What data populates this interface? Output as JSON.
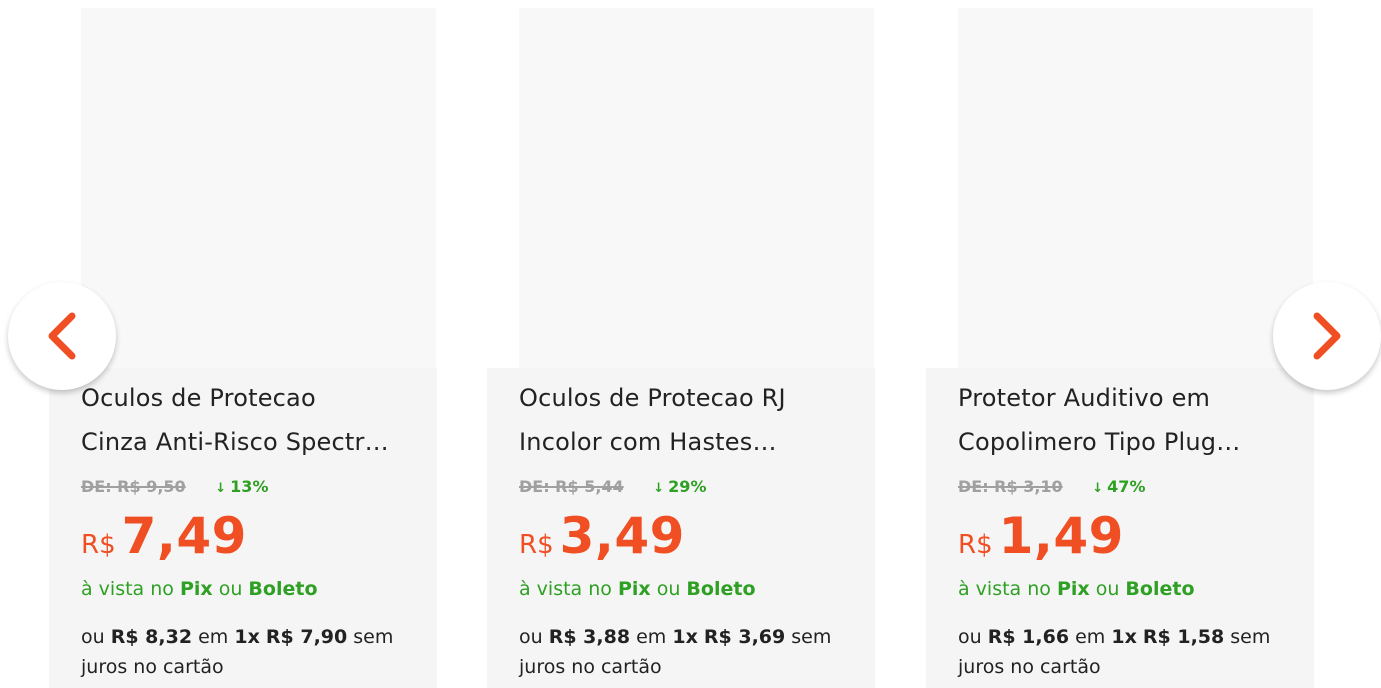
{
  "carousel": {
    "prev_icon": "chevron-left-icon",
    "next_icon": "chevron-right-icon",
    "accent_color": "#f04e23",
    "discount_color": "#2ea023"
  },
  "products": [
    {
      "title_line1": "Oculos de Protecao",
      "title_line2": "Cinza Anti-Risco Spectr…",
      "old_price": "DE: R$ 9,50",
      "discount": "13%",
      "currency": "R$",
      "price": "7,49",
      "pix_prefix": "à vista no",
      "pix_label": "Pix",
      "pix_or": "ou",
      "boleto_label": "Boleto",
      "inst_ou": "ou",
      "inst_total": "R$ 8,32",
      "inst_em": "em",
      "inst_count": "1x",
      "inst_value": "R$ 7,90",
      "inst_suffix": "sem juros no cartão"
    },
    {
      "title_line1": "Oculos de Protecao RJ",
      "title_line2": "Incolor com Hastes…",
      "old_price": "DE: R$ 5,44",
      "discount": "29%",
      "currency": "R$",
      "price": "3,49",
      "pix_prefix": "à vista no",
      "pix_label": "Pix",
      "pix_or": "ou",
      "boleto_label": "Boleto",
      "inst_ou": "ou",
      "inst_total": "R$ 3,88",
      "inst_em": "em",
      "inst_count": "1x",
      "inst_value": "R$ 3,69",
      "inst_suffix": "sem juros no cartão"
    },
    {
      "title_line1": "Protetor Auditivo em",
      "title_line2": "Copolimero Tipo Plug…",
      "old_price": "DE: R$ 3,10",
      "discount": "47%",
      "currency": "R$",
      "price": "1,49",
      "pix_prefix": "à vista no",
      "pix_label": "Pix",
      "pix_or": "ou",
      "boleto_label": "Boleto",
      "inst_ou": "ou",
      "inst_total": "R$ 1,66",
      "inst_em": "em",
      "inst_count": "1x",
      "inst_value": "R$ 1,58",
      "inst_suffix": "sem juros no cartão"
    }
  ]
}
